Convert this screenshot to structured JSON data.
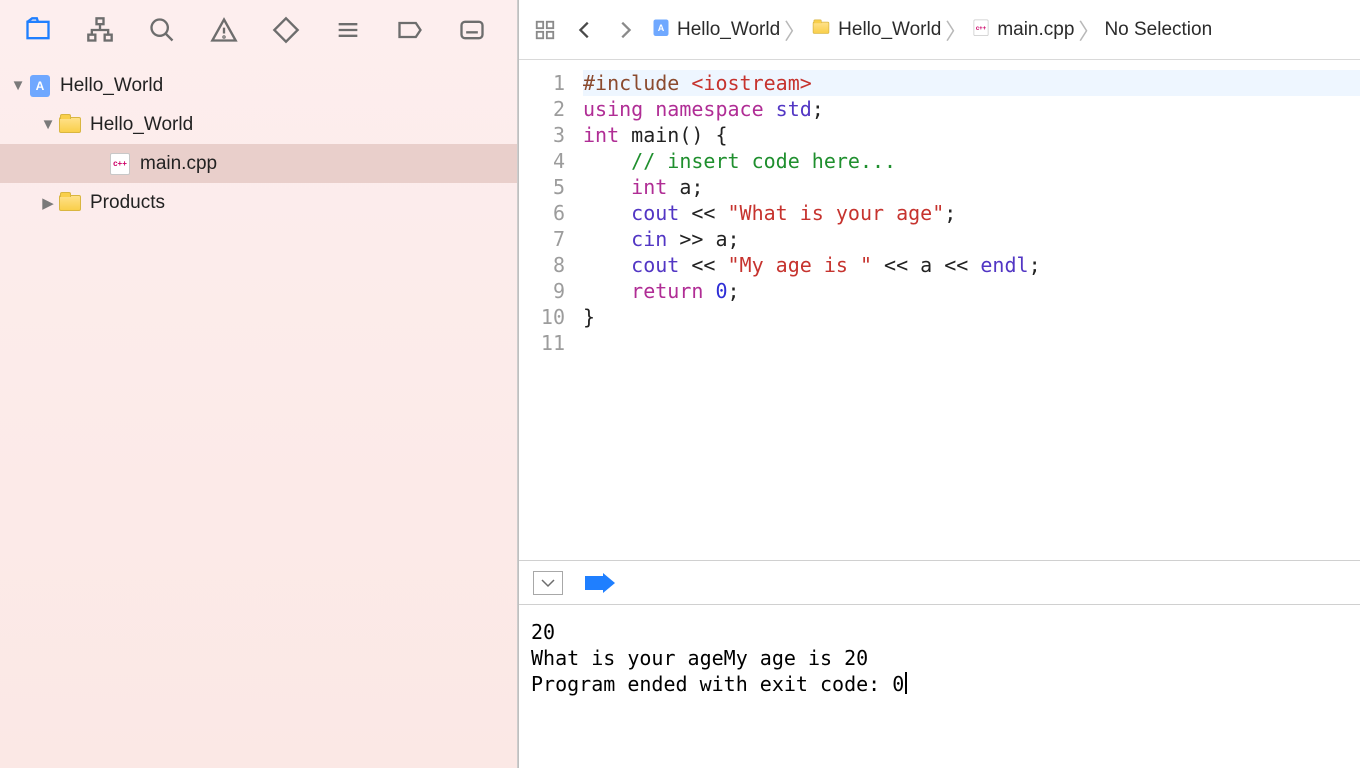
{
  "navigator": {
    "project": "Hello_World",
    "tree": [
      {
        "label": "Hello_World",
        "level": 0,
        "icon": "proj",
        "expanded": true,
        "selected": false,
        "twisty": "down"
      },
      {
        "label": "Hello_World",
        "level": 1,
        "icon": "folder",
        "expanded": true,
        "selected": false,
        "twisty": "down"
      },
      {
        "label": "main.cpp",
        "level": 2,
        "icon": "cpp",
        "expanded": false,
        "selected": true,
        "twisty": "none"
      },
      {
        "label": "Products",
        "level": 1,
        "icon": "folder",
        "expanded": false,
        "selected": false,
        "twisty": "right"
      }
    ]
  },
  "jumpbar": {
    "crumbs": [
      {
        "icon": "proj",
        "label": "Hello_World"
      },
      {
        "icon": "folder",
        "label": "Hello_World"
      },
      {
        "icon": "cpp",
        "label": "main.cpp"
      },
      {
        "icon": "",
        "label": "No Selection"
      }
    ]
  },
  "code": {
    "linecount": 11,
    "lines": [
      [
        {
          "c": "pre",
          "t": "#include "
        },
        {
          "c": "inc",
          "t": "<iostream>"
        }
      ],
      [
        {
          "c": "kw",
          "t": "using "
        },
        {
          "c": "kw",
          "t": "namespace "
        },
        {
          "c": "type",
          "t": "std"
        },
        {
          "c": "plain",
          "t": ";"
        }
      ],
      [
        {
          "c": "kw",
          "t": "int"
        },
        {
          "c": "plain",
          "t": " main() {"
        }
      ],
      [
        {
          "c": "plain",
          "t": "    "
        },
        {
          "c": "com",
          "t": "// insert code here..."
        }
      ],
      [
        {
          "c": "plain",
          "t": "    "
        },
        {
          "c": "kw",
          "t": "int"
        },
        {
          "c": "plain",
          "t": " a;"
        }
      ],
      [
        {
          "c": "plain",
          "t": "    "
        },
        {
          "c": "type",
          "t": "cout"
        },
        {
          "c": "plain",
          "t": " << "
        },
        {
          "c": "str",
          "t": "\"What is your age\""
        },
        {
          "c": "plain",
          "t": ";"
        }
      ],
      [
        {
          "c": "plain",
          "t": "    "
        },
        {
          "c": "type",
          "t": "cin"
        },
        {
          "c": "plain",
          "t": " >> a;"
        }
      ],
      [
        {
          "c": "plain",
          "t": "    "
        },
        {
          "c": "type",
          "t": "cout"
        },
        {
          "c": "plain",
          "t": " << "
        },
        {
          "c": "str",
          "t": "\"My age is \""
        },
        {
          "c": "plain",
          "t": " << a << "
        },
        {
          "c": "type",
          "t": "endl"
        },
        {
          "c": "plain",
          "t": ";"
        }
      ],
      [
        {
          "c": "plain",
          "t": "    "
        },
        {
          "c": "kw",
          "t": "return"
        },
        {
          "c": "plain",
          "t": " "
        },
        {
          "c": "num",
          "t": "0"
        },
        {
          "c": "plain",
          "t": ";"
        }
      ],
      [
        {
          "c": "plain",
          "t": "}"
        }
      ],
      [
        {
          "c": "plain",
          "t": ""
        }
      ]
    ],
    "highlight": 1
  },
  "console": {
    "lines": [
      "20",
      "What is your ageMy age is 20",
      "Program ended with exit code: 0"
    ]
  }
}
